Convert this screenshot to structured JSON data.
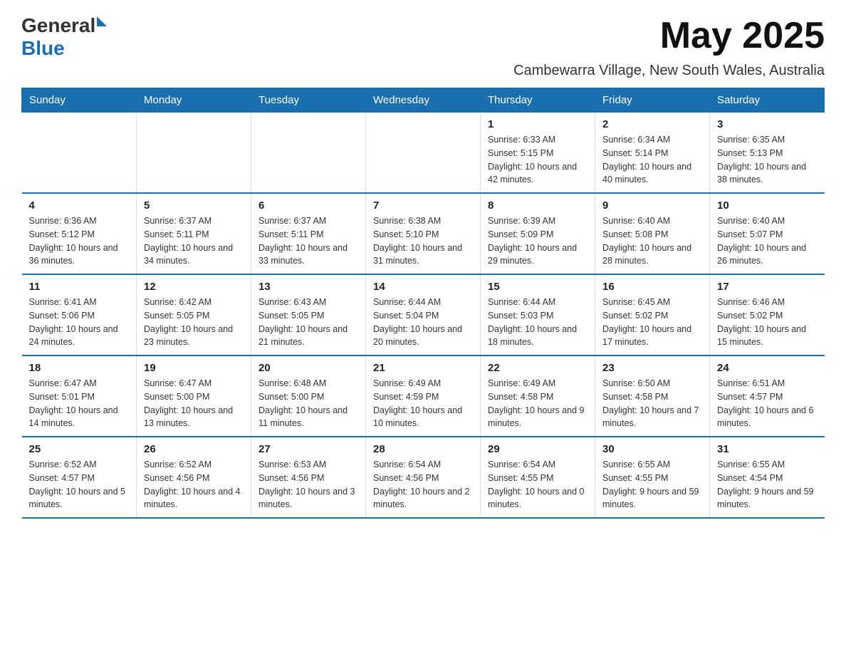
{
  "header": {
    "logo_general": "General",
    "logo_blue": "Blue",
    "month_title": "May 2025",
    "subtitle": "Cambewarra Village, New South Wales, Australia"
  },
  "weekdays": [
    "Sunday",
    "Monday",
    "Tuesday",
    "Wednesday",
    "Thursday",
    "Friday",
    "Saturday"
  ],
  "weeks": [
    [
      {
        "day": "",
        "info": ""
      },
      {
        "day": "",
        "info": ""
      },
      {
        "day": "",
        "info": ""
      },
      {
        "day": "",
        "info": ""
      },
      {
        "day": "1",
        "info": "Sunrise: 6:33 AM\nSunset: 5:15 PM\nDaylight: 10 hours and 42 minutes."
      },
      {
        "day": "2",
        "info": "Sunrise: 6:34 AM\nSunset: 5:14 PM\nDaylight: 10 hours and 40 minutes."
      },
      {
        "day": "3",
        "info": "Sunrise: 6:35 AM\nSunset: 5:13 PM\nDaylight: 10 hours and 38 minutes."
      }
    ],
    [
      {
        "day": "4",
        "info": "Sunrise: 6:36 AM\nSunset: 5:12 PM\nDaylight: 10 hours and 36 minutes."
      },
      {
        "day": "5",
        "info": "Sunrise: 6:37 AM\nSunset: 5:11 PM\nDaylight: 10 hours and 34 minutes."
      },
      {
        "day": "6",
        "info": "Sunrise: 6:37 AM\nSunset: 5:11 PM\nDaylight: 10 hours and 33 minutes."
      },
      {
        "day": "7",
        "info": "Sunrise: 6:38 AM\nSunset: 5:10 PM\nDaylight: 10 hours and 31 minutes."
      },
      {
        "day": "8",
        "info": "Sunrise: 6:39 AM\nSunset: 5:09 PM\nDaylight: 10 hours and 29 minutes."
      },
      {
        "day": "9",
        "info": "Sunrise: 6:40 AM\nSunset: 5:08 PM\nDaylight: 10 hours and 28 minutes."
      },
      {
        "day": "10",
        "info": "Sunrise: 6:40 AM\nSunset: 5:07 PM\nDaylight: 10 hours and 26 minutes."
      }
    ],
    [
      {
        "day": "11",
        "info": "Sunrise: 6:41 AM\nSunset: 5:06 PM\nDaylight: 10 hours and 24 minutes."
      },
      {
        "day": "12",
        "info": "Sunrise: 6:42 AM\nSunset: 5:05 PM\nDaylight: 10 hours and 23 minutes."
      },
      {
        "day": "13",
        "info": "Sunrise: 6:43 AM\nSunset: 5:05 PM\nDaylight: 10 hours and 21 minutes."
      },
      {
        "day": "14",
        "info": "Sunrise: 6:44 AM\nSunset: 5:04 PM\nDaylight: 10 hours and 20 minutes."
      },
      {
        "day": "15",
        "info": "Sunrise: 6:44 AM\nSunset: 5:03 PM\nDaylight: 10 hours and 18 minutes."
      },
      {
        "day": "16",
        "info": "Sunrise: 6:45 AM\nSunset: 5:02 PM\nDaylight: 10 hours and 17 minutes."
      },
      {
        "day": "17",
        "info": "Sunrise: 6:46 AM\nSunset: 5:02 PM\nDaylight: 10 hours and 15 minutes."
      }
    ],
    [
      {
        "day": "18",
        "info": "Sunrise: 6:47 AM\nSunset: 5:01 PM\nDaylight: 10 hours and 14 minutes."
      },
      {
        "day": "19",
        "info": "Sunrise: 6:47 AM\nSunset: 5:00 PM\nDaylight: 10 hours and 13 minutes."
      },
      {
        "day": "20",
        "info": "Sunrise: 6:48 AM\nSunset: 5:00 PM\nDaylight: 10 hours and 11 minutes."
      },
      {
        "day": "21",
        "info": "Sunrise: 6:49 AM\nSunset: 4:59 PM\nDaylight: 10 hours and 10 minutes."
      },
      {
        "day": "22",
        "info": "Sunrise: 6:49 AM\nSunset: 4:58 PM\nDaylight: 10 hours and 9 minutes."
      },
      {
        "day": "23",
        "info": "Sunrise: 6:50 AM\nSunset: 4:58 PM\nDaylight: 10 hours and 7 minutes."
      },
      {
        "day": "24",
        "info": "Sunrise: 6:51 AM\nSunset: 4:57 PM\nDaylight: 10 hours and 6 minutes."
      }
    ],
    [
      {
        "day": "25",
        "info": "Sunrise: 6:52 AM\nSunset: 4:57 PM\nDaylight: 10 hours and 5 minutes."
      },
      {
        "day": "26",
        "info": "Sunrise: 6:52 AM\nSunset: 4:56 PM\nDaylight: 10 hours and 4 minutes."
      },
      {
        "day": "27",
        "info": "Sunrise: 6:53 AM\nSunset: 4:56 PM\nDaylight: 10 hours and 3 minutes."
      },
      {
        "day": "28",
        "info": "Sunrise: 6:54 AM\nSunset: 4:56 PM\nDaylight: 10 hours and 2 minutes."
      },
      {
        "day": "29",
        "info": "Sunrise: 6:54 AM\nSunset: 4:55 PM\nDaylight: 10 hours and 0 minutes."
      },
      {
        "day": "30",
        "info": "Sunrise: 6:55 AM\nSunset: 4:55 PM\nDaylight: 9 hours and 59 minutes."
      },
      {
        "day": "31",
        "info": "Sunrise: 6:55 AM\nSunset: 4:54 PM\nDaylight: 9 hours and 59 minutes."
      }
    ]
  ]
}
